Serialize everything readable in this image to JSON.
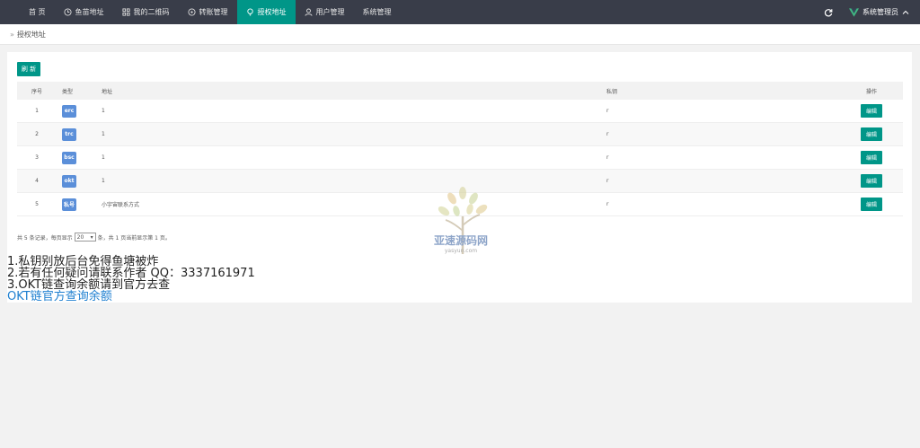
{
  "nav": {
    "items": [
      {
        "label": "首 页",
        "icon": "none"
      },
      {
        "label": "鱼苗地址",
        "icon": "clock-icon"
      },
      {
        "label": "我的二维码",
        "icon": "grid-icon"
      },
      {
        "label": "转账管理",
        "icon": "transfer-icon"
      },
      {
        "label": "授权地址",
        "icon": "bulb-icon",
        "active": true
      },
      {
        "label": "用户管理",
        "icon": "user-icon"
      },
      {
        "label": "系统管理",
        "icon": "none"
      }
    ],
    "user_label": "系统管理员",
    "active_color": "#009688"
  },
  "breadcrumb": {
    "current": "授权地址"
  },
  "toolbar": {
    "refresh_label": "刷 新"
  },
  "table": {
    "headers": [
      "序号",
      "类型",
      "地址",
      "私钥",
      "操作"
    ],
    "rows": [
      {
        "idx": "1",
        "type": "erc",
        "addr": "1",
        "key": "r",
        "op": "编辑"
      },
      {
        "idx": "2",
        "type": "trc",
        "addr": "1",
        "key": "r",
        "op": "编辑"
      },
      {
        "idx": "3",
        "type": "bsc",
        "addr": "1",
        "key": "r",
        "op": "编辑"
      },
      {
        "idx": "4",
        "type": "okt",
        "addr": "1",
        "key": "r",
        "op": "编辑"
      },
      {
        "idx": "5",
        "type": "私号",
        "addr": "小宇宙联系方式",
        "key": "r",
        "op": "编辑"
      }
    ]
  },
  "pager": {
    "prefix": "共 5 条记录，每页显示",
    "page_size": "20",
    "suffix": "条，共 1 页当前显示第 1 页。"
  },
  "watermark": {
    "text": "亚速源码网",
    "sub": "yasyun.com"
  },
  "notice": {
    "line1": "1.私钥别放后台免得鱼塘被炸",
    "line2": "2.若有任何疑问请联系作者 QQ：3337161971",
    "line3": "3.OKT链查询余额请到官方去查",
    "link": "OKT链官方查询余额"
  }
}
